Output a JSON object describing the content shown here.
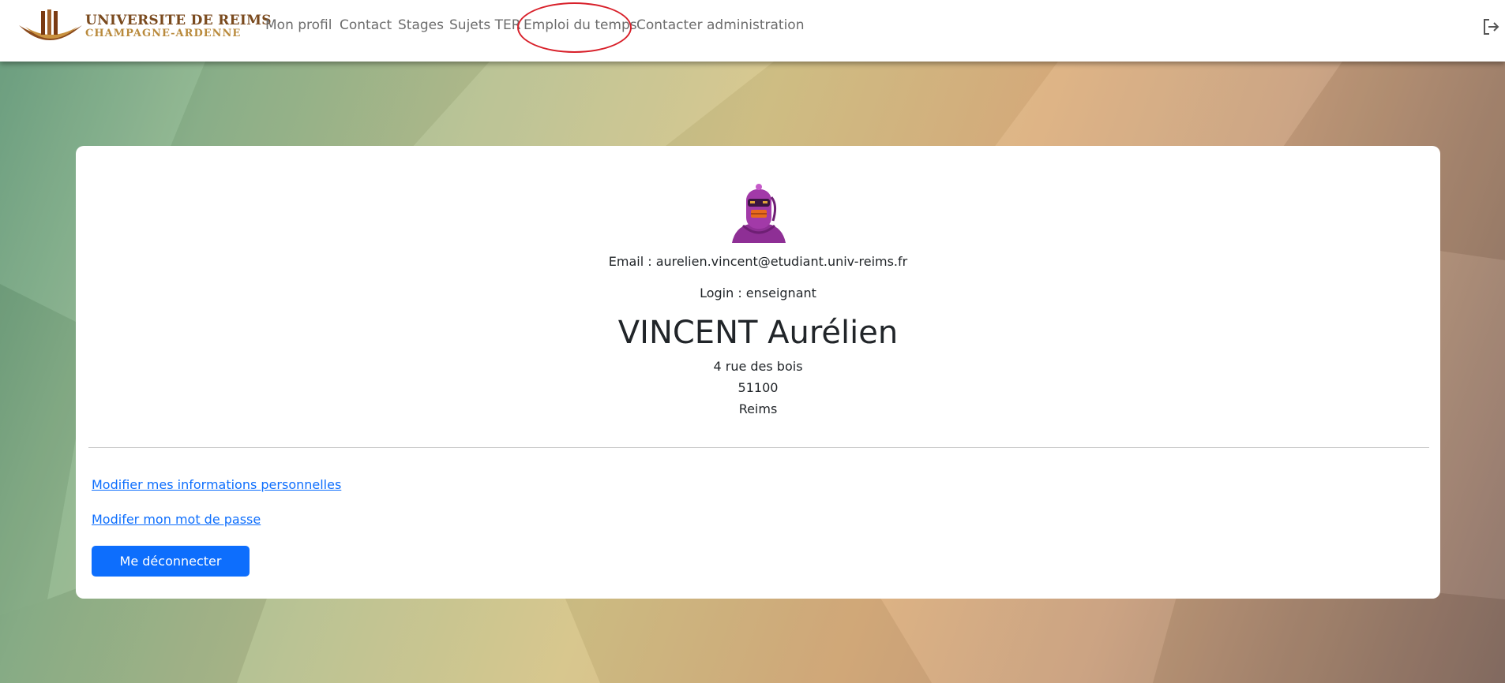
{
  "brand": {
    "line1": "UNIVERSITE DE REIMS",
    "line2": "CHAMPAGNE-ARDENNE",
    "logo_icon": "university-logo-icon"
  },
  "nav": {
    "items": [
      {
        "label": "Mon profil"
      },
      {
        "label": "Contact"
      },
      {
        "label": "Stages"
      },
      {
        "label": "Sujets TER"
      },
      {
        "label": "Emploi du temps"
      },
      {
        "label": "Contacter administration"
      }
    ],
    "logout_icon": "logout-icon"
  },
  "profile": {
    "avatar_icon": "robot-avatar-icon",
    "email": "Email : aurelien.vincent@etudiant.univ-reims.fr",
    "login": "Login : enseignant",
    "name": "VINCENT Aurélien",
    "address_line1": "4 rue des bois",
    "postal_code": "51100",
    "city": "Reims"
  },
  "actions": {
    "edit_info": "Modifier mes informations personnelles",
    "edit_password": "Modifer mon mot de passe",
    "logout_button": "Me déconnecter"
  },
  "colors": {
    "accent": "#0d6efd",
    "highlight": "#d8202a"
  }
}
